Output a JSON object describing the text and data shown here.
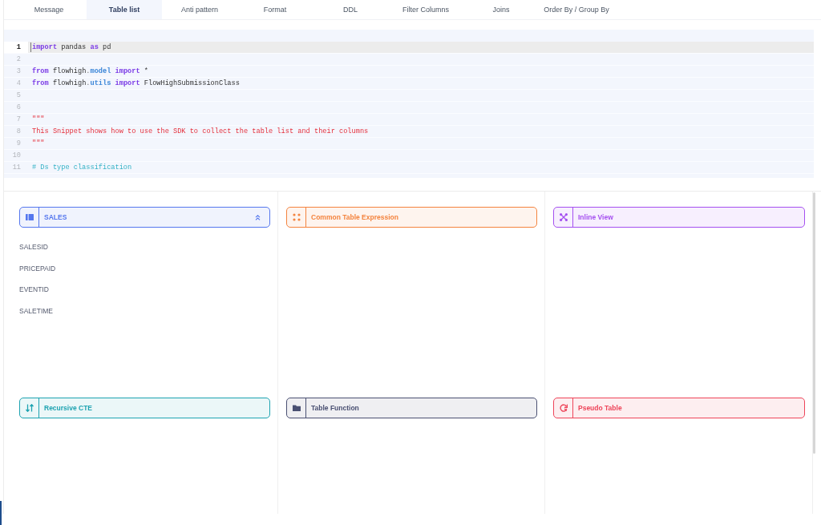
{
  "tabs": [
    {
      "label": "Message",
      "selected": false
    },
    {
      "label": "Table list",
      "selected": true
    },
    {
      "label": "Anti pattern",
      "selected": false
    },
    {
      "label": "Format",
      "selected": false
    },
    {
      "label": "DDL",
      "selected": false
    },
    {
      "label": "Filter Columns",
      "selected": false
    },
    {
      "label": "Joins",
      "selected": false
    },
    {
      "label": "Order By / Group By",
      "selected": false
    }
  ],
  "editor": {
    "lines": [
      {
        "number": "1",
        "active": true,
        "tokens": [
          {
            "kind": "keyword",
            "text": "import"
          },
          {
            "kind": "name",
            "text": " pandas "
          },
          {
            "kind": "keyword",
            "text": "as"
          },
          {
            "kind": "name",
            "text": " pd"
          }
        ]
      },
      {
        "number": "2",
        "active": false
      },
      {
        "number": "3",
        "active": false,
        "tokens": [
          {
            "kind": "keyword",
            "text": "from"
          },
          {
            "kind": "name",
            "text": " flowhigh"
          },
          {
            "kind": "punctuation",
            "text": "."
          },
          {
            "kind": "property",
            "text": "model"
          },
          {
            "kind": "keyword",
            "text": " import"
          },
          {
            "kind": "name",
            "text": " *"
          }
        ]
      },
      {
        "number": "4",
        "active": false,
        "tokens": [
          {
            "kind": "keyword",
            "text": "from"
          },
          {
            "kind": "name",
            "text": " flowhigh"
          },
          {
            "kind": "punctuation",
            "text": "."
          },
          {
            "kind": "property",
            "text": "utils"
          },
          {
            "kind": "keyword",
            "text": " import"
          },
          {
            "kind": "name",
            "text": " FlowHighSubmissionClass"
          }
        ]
      },
      {
        "number": "5",
        "active": false
      },
      {
        "number": "6",
        "active": false
      },
      {
        "number": "7",
        "active": false,
        "tokens": [
          {
            "kind": "string",
            "text": "\"\"\""
          }
        ]
      },
      {
        "number": "8",
        "active": false,
        "tokens": [
          {
            "kind": "string",
            "text": "This Snippet shows how to use the SDK to collect the table list and their columns"
          }
        ]
      },
      {
        "number": "9",
        "active": false,
        "tokens": [
          {
            "kind": "string",
            "text": "\"\"\""
          }
        ]
      },
      {
        "number": "10",
        "active": false
      },
      {
        "number": "11",
        "active": false,
        "tokens": [
          {
            "kind": "comment",
            "text": "# Ds type classification"
          }
        ]
      }
    ]
  },
  "sources": [
    {
      "kind": "table",
      "title": "SALES",
      "color": "#5577ee",
      "expanded": true,
      "columns": [
        "SALESID",
        "PRICEPAID",
        "EVENTID",
        "SALETIME"
      ]
    },
    {
      "kind": "cte",
      "title": "Common Table Expression",
      "color": "#f4843f"
    },
    {
      "kind": "inline_view",
      "title": "Inline View",
      "color": "#a550f0"
    },
    {
      "kind": "recursive_cte",
      "title": "Recursive CTE",
      "color": "#1ea3b1"
    },
    {
      "kind": "table_function",
      "title": "Table Function",
      "color": "#4a5072"
    },
    {
      "kind": "pseudo_table",
      "title": "Pseudo Table",
      "color": "#ee4459"
    }
  ]
}
